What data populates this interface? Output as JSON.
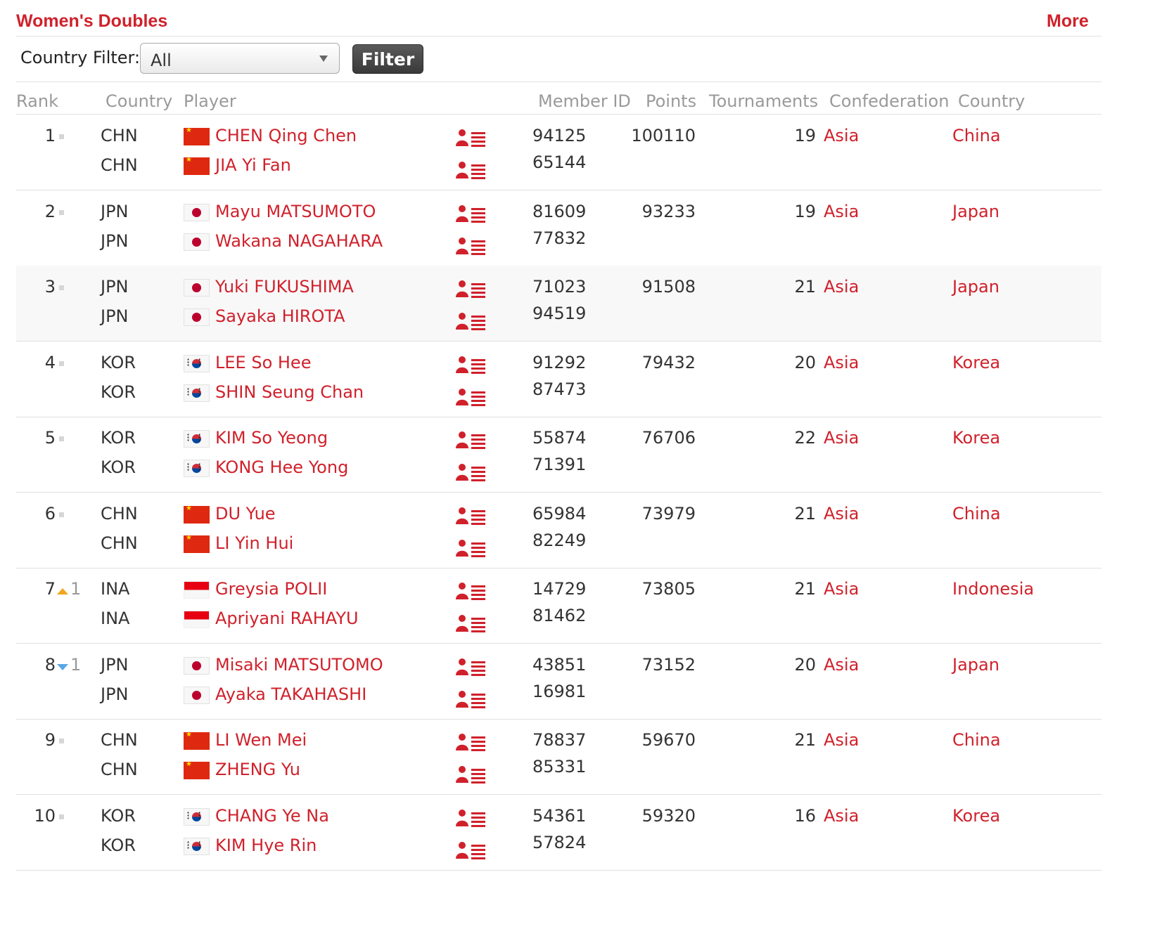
{
  "header": {
    "title": "Women's Doubles",
    "more_label": "More"
  },
  "filter": {
    "label": "Country Filter:",
    "selected": "All",
    "button_label": "Filter"
  },
  "columns": {
    "rank": "Rank",
    "country": "Country",
    "player": "Player",
    "member_id": "Member ID",
    "points": "Points",
    "tournaments": "Tournaments",
    "confederation": "Confederation",
    "country2": "Country"
  },
  "colors": {
    "link": "#d0212b",
    "up": "#f2a51c",
    "down": "#5aa7e6"
  },
  "icons": {
    "profile": "player-profile-icon",
    "unchanged": "rank-unchanged-icon",
    "up": "rank-up-icon",
    "down": "rank-down-icon"
  },
  "rows": [
    {
      "rank": "1",
      "change_type": "same",
      "change": "",
      "points": "100110",
      "tournaments": "19",
      "confederation": "Asia",
      "country_name": "China",
      "players": [
        {
          "country": "CHN",
          "flag": "chn",
          "name": "CHEN Qing Chen",
          "member_id": "94125"
        },
        {
          "country": "CHN",
          "flag": "chn",
          "name": "JIA Yi Fan",
          "member_id": "65144"
        }
      ]
    },
    {
      "rank": "2",
      "change_type": "same",
      "change": "",
      "points": "93233",
      "tournaments": "19",
      "confederation": "Asia",
      "country_name": "Japan",
      "players": [
        {
          "country": "JPN",
          "flag": "jpn",
          "name": "Mayu MATSUMOTO",
          "member_id": "81609"
        },
        {
          "country": "JPN",
          "flag": "jpn",
          "name": "Wakana NAGAHARA",
          "member_id": "77832"
        }
      ]
    },
    {
      "rank": "3",
      "change_type": "same",
      "change": "",
      "points": "91508",
      "tournaments": "21",
      "confederation": "Asia",
      "country_name": "Japan",
      "players": [
        {
          "country": "JPN",
          "flag": "jpn",
          "name": "Yuki FUKUSHIMA",
          "member_id": "71023"
        },
        {
          "country": "JPN",
          "flag": "jpn",
          "name": "Sayaka HIROTA",
          "member_id": "94519"
        }
      ]
    },
    {
      "rank": "4",
      "change_type": "same",
      "change": "",
      "points": "79432",
      "tournaments": "20",
      "confederation": "Asia",
      "country_name": "Korea",
      "players": [
        {
          "country": "KOR",
          "flag": "kor",
          "name": "LEE So Hee",
          "member_id": "91292"
        },
        {
          "country": "KOR",
          "flag": "kor",
          "name": "SHIN Seung Chan",
          "member_id": "87473"
        }
      ]
    },
    {
      "rank": "5",
      "change_type": "same",
      "change": "",
      "points": "76706",
      "tournaments": "22",
      "confederation": "Asia",
      "country_name": "Korea",
      "players": [
        {
          "country": "KOR",
          "flag": "kor",
          "name": "KIM So Yeong",
          "member_id": "55874"
        },
        {
          "country": "KOR",
          "flag": "kor",
          "name": "KONG Hee Yong",
          "member_id": "71391"
        }
      ]
    },
    {
      "rank": "6",
      "change_type": "same",
      "change": "",
      "points": "73979",
      "tournaments": "21",
      "confederation": "Asia",
      "country_name": "China",
      "players": [
        {
          "country": "CHN",
          "flag": "chn",
          "name": "DU Yue",
          "member_id": "65984"
        },
        {
          "country": "CHN",
          "flag": "chn",
          "name": "LI Yin Hui",
          "member_id": "82249"
        }
      ]
    },
    {
      "rank": "7",
      "change_type": "up",
      "change": "1",
      "points": "73805",
      "tournaments": "21",
      "confederation": "Asia",
      "country_name": "Indonesia",
      "players": [
        {
          "country": "INA",
          "flag": "ina",
          "name": "Greysia POLII",
          "member_id": "14729"
        },
        {
          "country": "INA",
          "flag": "ina",
          "name": "Apriyani RAHAYU",
          "member_id": "81462"
        }
      ]
    },
    {
      "rank": "8",
      "change_type": "down",
      "change": "1",
      "points": "73152",
      "tournaments": "20",
      "confederation": "Asia",
      "country_name": "Japan",
      "players": [
        {
          "country": "JPN",
          "flag": "jpn",
          "name": "Misaki MATSUTOMO",
          "member_id": "43851"
        },
        {
          "country": "JPN",
          "flag": "jpn",
          "name": "Ayaka TAKAHASHI",
          "member_id": "16981"
        }
      ]
    },
    {
      "rank": "9",
      "change_type": "same",
      "change": "",
      "points": "59670",
      "tournaments": "21",
      "confederation": "Asia",
      "country_name": "China",
      "players": [
        {
          "country": "CHN",
          "flag": "chn",
          "name": "LI Wen Mei",
          "member_id": "78837"
        },
        {
          "country": "CHN",
          "flag": "chn",
          "name": "ZHENG Yu",
          "member_id": "85331"
        }
      ]
    },
    {
      "rank": "10",
      "change_type": "same",
      "change": "",
      "points": "59320",
      "tournaments": "16",
      "confederation": "Asia",
      "country_name": "Korea",
      "players": [
        {
          "country": "KOR",
          "flag": "kor",
          "name": "CHANG Ye Na",
          "member_id": "54361"
        },
        {
          "country": "KOR",
          "flag": "kor",
          "name": "KIM Hye Rin",
          "member_id": "57824"
        }
      ]
    }
  ]
}
